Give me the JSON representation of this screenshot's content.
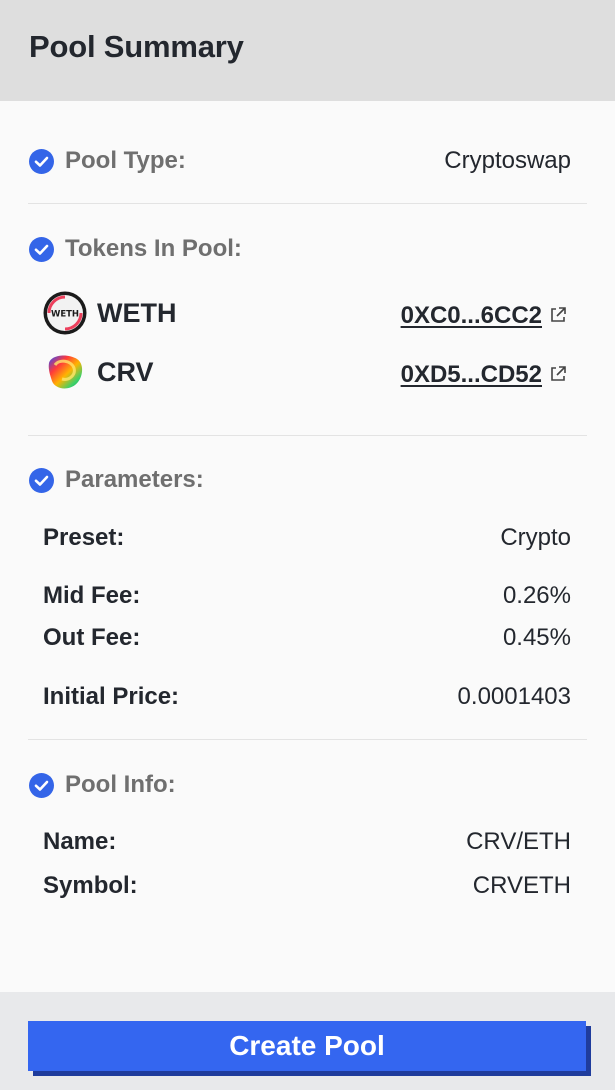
{
  "header": {
    "title": "Pool Summary"
  },
  "pool_type": {
    "label": "Pool Type:",
    "value": "Cryptoswap"
  },
  "tokens": {
    "label": "Tokens In Pool:",
    "items": [
      {
        "symbol": "WETH",
        "address": "0XC0...6CC2",
        "icon": "weth-token-icon",
        "icon_text": "WETH"
      },
      {
        "symbol": "CRV",
        "address": "0XD5...CD52",
        "icon": "crv-token-icon"
      }
    ]
  },
  "parameters": {
    "label": "Parameters:",
    "preset": {
      "label": "Preset:",
      "value": "Crypto"
    },
    "mid_fee": {
      "label": "Mid Fee:",
      "value": "0.26%"
    },
    "out_fee": {
      "label": "Out Fee:",
      "value": "0.45%"
    },
    "initial_price": {
      "label": "Initial Price:",
      "value": "0.0001403"
    }
  },
  "pool_info": {
    "label": "Pool Info:",
    "name": {
      "label": "Name:",
      "value": "CRV/ETH"
    },
    "symbol": {
      "label": "Symbol:",
      "value": "CRVETH"
    }
  },
  "footer": {
    "create_label": "Create Pool"
  },
  "colors": {
    "accent": "#3466f0",
    "check": "#3465e8",
    "header_bg": "#dedede"
  }
}
